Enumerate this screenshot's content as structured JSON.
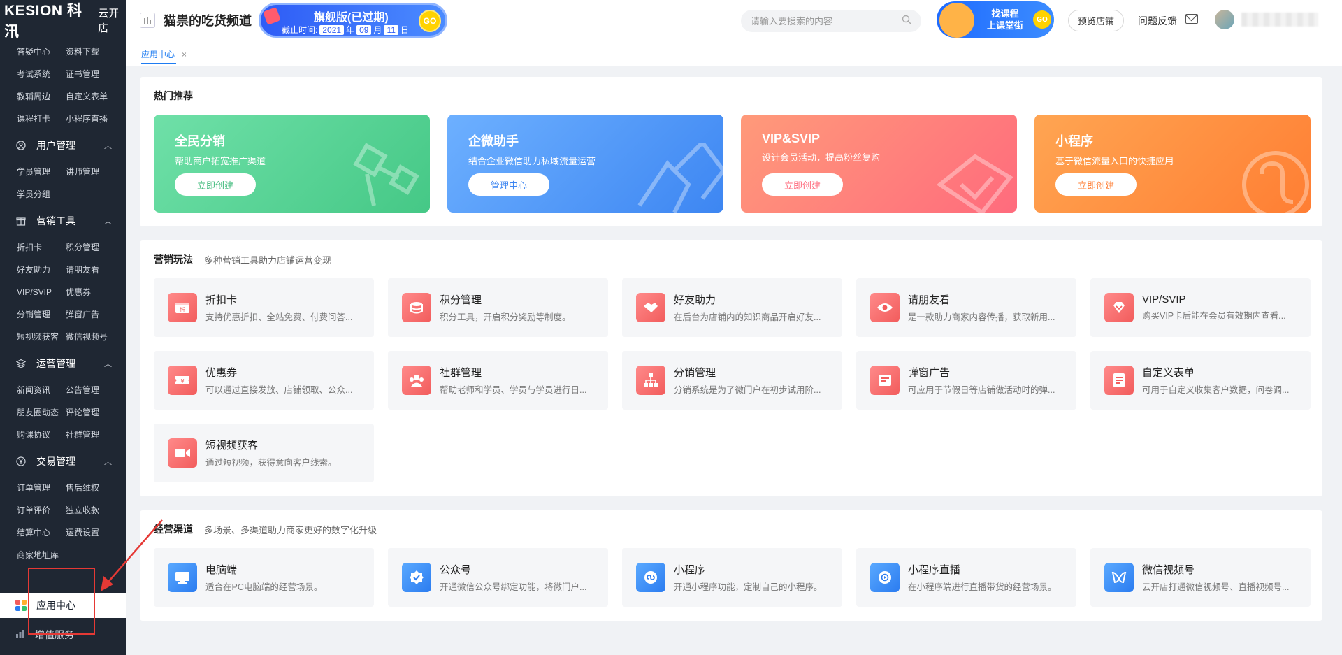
{
  "app": {
    "brand": "KESION 科汛",
    "brand_sub": "云开店",
    "shop_name": "猫祟的吃货频道",
    "version_title": "旗舰版(已过期)",
    "expire_label": "截止时间:",
    "expire_year": "2021",
    "expire_year_unit": "年",
    "expire_month": "09",
    "expire_month_unit": "月",
    "expire_day": "11",
    "expire_day_unit": "日",
    "go": "GO",
    "search_placeholder": "请输入要搜索的内容",
    "course_banner_line1": "找课程",
    "course_banner_line2": "上课堂街",
    "preview_store": "预览店铺",
    "feedback": "问题反馈"
  },
  "sidebar": {
    "top_items": [
      "答疑中心",
      "资料下载",
      "考试系统",
      "证书管理",
      "教辅周边",
      "自定义表单",
      "课程打卡",
      "小程序直播"
    ],
    "groups": [
      {
        "title": "用户管理",
        "items": [
          "学员管理",
          "讲师管理",
          "学员分组"
        ]
      },
      {
        "title": "营销工具",
        "items": [
          "折扣卡",
          "积分管理",
          "好友助力",
          "请朋友看",
          "VIP/SVIP",
          "优惠券",
          "分销管理",
          "弹窗广告",
          "短视频获客",
          "微信视频号"
        ]
      },
      {
        "title": "运营管理",
        "items": [
          "新闻资讯",
          "公告管理",
          "朋友圈动态",
          "评论管理",
          "购课协议",
          "社群管理"
        ]
      },
      {
        "title": "交易管理",
        "items": [
          "订单管理",
          "售后维权",
          "订单评价",
          "独立收款",
          "结算中心",
          "运费设置",
          "商家地址库"
        ]
      }
    ],
    "active_item": "应用中心",
    "extra_item": "增值服务"
  },
  "tabs": {
    "active": "应用中心",
    "close": "×"
  },
  "hot": {
    "title": "热门推荐",
    "cards": [
      {
        "title": "全民分销",
        "desc": "帮助商户拓宽推广渠道",
        "button": "立即创建"
      },
      {
        "title": "企微助手",
        "desc": "结合企业微信助力私域流量运营",
        "button": "管理中心"
      },
      {
        "title": "VIP&SVIP",
        "desc": "设计会员活动，提高粉丝复购",
        "button": "立即创建"
      },
      {
        "title": "小程序",
        "desc": "基于微信流量入口的快捷应用",
        "button": "立即创建"
      }
    ]
  },
  "marketing": {
    "title": "营销玩法",
    "desc": "多种营销工具助力店铺运营变现",
    "tools": [
      {
        "name": "折扣卡",
        "desc": "支持优惠折扣、全站免费、付费问答..."
      },
      {
        "name": "积分管理",
        "desc": "积分工具，开启积分奖励等制度。"
      },
      {
        "name": "好友助力",
        "desc": "在后台为店铺内的知识商品开启好友..."
      },
      {
        "name": "请朋友看",
        "desc": "是一款助力商家内容传播，获取新用..."
      },
      {
        "name": "VIP/SVIP",
        "desc": "购买VIP卡后能在会员有效期内查看..."
      },
      {
        "name": "优惠券",
        "desc": "可以通过直接发放、店铺领取、公众..."
      },
      {
        "name": "社群管理",
        "desc": "帮助老师和学员、学员与学员进行日..."
      },
      {
        "name": "分销管理",
        "desc": "分销系统是为了微门户在初步试用阶..."
      },
      {
        "name": "弹窗广告",
        "desc": "可应用于节假日等店铺做活动时的弹..."
      },
      {
        "name": "自定义表单",
        "desc": "可用于自定义收集客户数据，问卷调..."
      },
      {
        "name": "短视频获客",
        "desc": "通过短视频，获得意向客户线索。"
      }
    ]
  },
  "channels": {
    "title": "经营渠道",
    "desc": "多场景、多渠道助力商家更好的数字化升级",
    "tools": [
      {
        "name": "电脑端",
        "desc": "适合在PC电脑端的经营场景。"
      },
      {
        "name": "公众号",
        "desc": "开通微信公众号绑定功能，将微门户..."
      },
      {
        "name": "小程序",
        "desc": "开通小程序功能，定制自己的小程序。"
      },
      {
        "name": "小程序直播",
        "desc": "在小程序端进行直播带货的经营场景。"
      },
      {
        "name": "微信视频号",
        "desc": "云开店打通微信视频号、直播视频号..."
      }
    ]
  },
  "colors": {
    "sidebar_bg": "#1f2733",
    "accent": "#1e7cf2",
    "card_green": "#4fcf8c",
    "card_blue": "#4a8ef5",
    "card_red": "#ff7a80",
    "card_orange": "#ff8a3d",
    "annotation": "#e53935"
  }
}
